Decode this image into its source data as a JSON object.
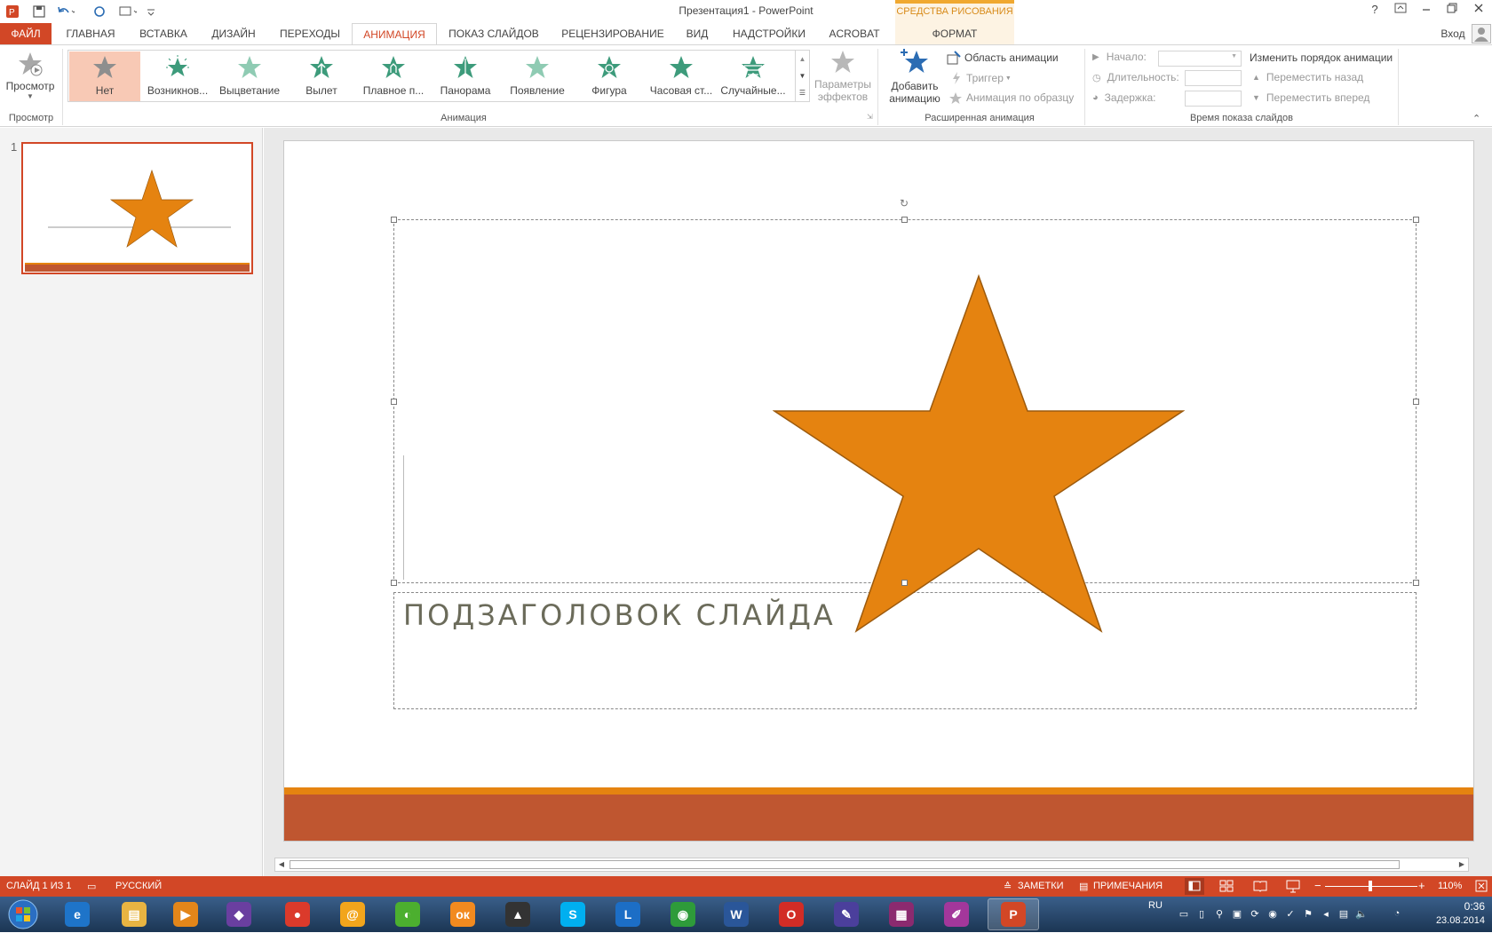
{
  "window": {
    "title": "Презентация1 - PowerPoint",
    "help": "?",
    "signin": "Вход",
    "contextual_group": "СРЕДСТВА РИСОВАНИЯ"
  },
  "tabs": [
    {
      "label": "ФАЙЛ"
    },
    {
      "label": "ГЛАВНАЯ"
    },
    {
      "label": "ВСТАВКА"
    },
    {
      "label": "ДИЗАЙН"
    },
    {
      "label": "ПЕРЕХОДЫ"
    },
    {
      "label": "АНИМАЦИЯ"
    },
    {
      "label": "ПОКАЗ СЛАЙДОВ"
    },
    {
      "label": "РЕЦЕНЗИРОВАНИЕ"
    },
    {
      "label": "ВИД"
    },
    {
      "label": "НАДСТРОЙКИ"
    },
    {
      "label": "ACROBAT"
    },
    {
      "label": "ФОРМАТ"
    }
  ],
  "ribbon": {
    "preview": {
      "button": "Просмотр",
      "group": "Просмотр"
    },
    "animation": {
      "group": "Анимация",
      "items": [
        {
          "label": "Нет",
          "color": "#9a9a9a"
        },
        {
          "label": "Возникнов...",
          "color": "#3d9b7b"
        },
        {
          "label": "Выцветание",
          "color": "#7fc0a8"
        },
        {
          "label": "Вылет",
          "color": "#3d9b7b"
        },
        {
          "label": "Плавное п...",
          "color": "#3d9b7b"
        },
        {
          "label": "Панорама",
          "color": "#3d9b7b"
        },
        {
          "label": "Появление",
          "color": "#7fc0a8"
        },
        {
          "label": "Фигура",
          "color": "#3d9b7b"
        },
        {
          "label": "Часовая ст...",
          "color": "#3d9b7b"
        },
        {
          "label": "Случайные...",
          "color": "#3d9b7b"
        }
      ],
      "effect_options_line1": "Параметры",
      "effect_options_line2": "эффектов"
    },
    "advanced": {
      "group": "Расширенная анимация",
      "add_line1": "Добавить",
      "add_line2": "анимацию",
      "pane": "Область анимации",
      "trigger": "Триггер",
      "painter": "Анимация по образцу"
    },
    "timing": {
      "group": "Время показа слайдов",
      "start": "Начало:",
      "duration": "Длительность:",
      "delay": "Задержка:",
      "reorder": "Изменить порядок анимации",
      "move_back": "Переместить назад",
      "move_forward": "Переместить вперед"
    }
  },
  "slides_pane": {
    "number": "1"
  },
  "slide": {
    "subtitle": "ПОДЗАГОЛОВОК СЛАЙДА",
    "star_color": "#e58310",
    "star_stroke": "#9c5a0d",
    "footer_band": "#bf5630",
    "footer_line": "#e58310"
  },
  "status": {
    "slide_info": "СЛАЙД 1 ИЗ 1",
    "language": "РУССКИЙ",
    "notes": "ЗАМЕТКИ",
    "comments": "ПРИМЕЧАНИЯ",
    "zoom": "110%"
  },
  "taskbar": {
    "apps": [
      {
        "name": "ie-icon",
        "color": "#1e74c9",
        "glyph": "e"
      },
      {
        "name": "explorer-icon",
        "color": "#e8b442",
        "glyph": "▤"
      },
      {
        "name": "media-player-icon",
        "color": "#e3861a",
        "glyph": "▶"
      },
      {
        "name": "visual-studio-icon",
        "color": "#6a3fa0",
        "glyph": "◆"
      },
      {
        "name": "chrome-icon",
        "color": "#db3a2b",
        "glyph": "●"
      },
      {
        "name": "mail-agent-icon",
        "color": "#f2a51c",
        "glyph": "@"
      },
      {
        "name": "ball-app-icon",
        "color": "#4caf2f",
        "glyph": "◐"
      },
      {
        "name": "odnoklassniki-icon",
        "color": "#f28a1f",
        "glyph": "ок"
      },
      {
        "name": "aimp-icon",
        "color": "#333333",
        "glyph": "▲"
      },
      {
        "name": "skype-icon",
        "color": "#00aff0",
        "glyph": "S"
      },
      {
        "name": "lync-icon",
        "color": "#1c6ec6",
        "glyph": "L"
      },
      {
        "name": "radio-icon",
        "color": "#2e9b3a",
        "glyph": "◉"
      },
      {
        "name": "word-icon",
        "color": "#2a5699",
        "glyph": "W"
      },
      {
        "name": "opera-icon",
        "color": "#d22c26",
        "glyph": "O"
      },
      {
        "name": "draw-app-icon",
        "color": "#4b3f9c",
        "glyph": "✎"
      },
      {
        "name": "winrar-icon",
        "color": "#8b2a6f",
        "glyph": "▦"
      },
      {
        "name": "onenote-icon",
        "color": "#a3379b",
        "glyph": "✐"
      },
      {
        "name": "powerpoint-icon",
        "color": "#d24726",
        "glyph": "P"
      }
    ],
    "lang": "RU",
    "time": "0:36",
    "date": "23.08.2014"
  }
}
